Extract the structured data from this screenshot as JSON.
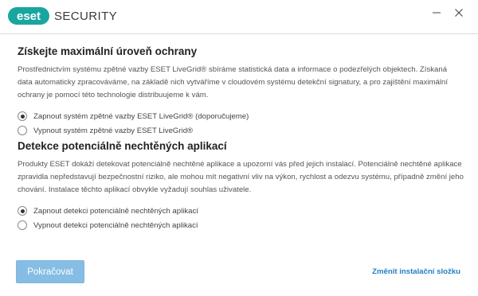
{
  "header": {
    "logo_text": "eset",
    "product_name": "SECURITY",
    "minimize_icon": "minimize-icon",
    "close_icon": "close-icon"
  },
  "livegrid": {
    "title": "Získejte maximální úroveň ochrany",
    "description": "Prostřednictvím systému zpětné vazby ESET LiveGrid® sbíráme statistická data a informace o podezřelých objektech. Získaná data automaticky zpracováváme, na základě nich vytváříme v cloudovém systému detekční signatury, a pro zajištění maximální ochrany je pomocí této technologie distribuujeme k vám.",
    "options": [
      {
        "label": "Zapnout systém zpětné vazby ESET LiveGrid® (doporučujeme)",
        "checked": true
      },
      {
        "label": "Vypnout systém zpětné vazby ESET LiveGrid®",
        "checked": false
      }
    ]
  },
  "pua": {
    "title": "Detekce potenciálně nechtěných aplikací",
    "description": "Produkty ESET dokáží detekovat potenciálně nechtěné aplikace a upozorní vás před jejich instalací. Potenciálně nechtěné aplikace zpravidla nepředstavují bezpečnostní riziko, ale mohou mít negativní vliv na výkon, rychlost a odezvu systému, případně změní jeho chování. Instalace těchto aplikací obvykle vyžadují souhlas uživatele.",
    "options": [
      {
        "label": "Zapnout detekci potenciálně nechtěných aplikací",
        "checked": true
      },
      {
        "label": "Vypnout detekci potenciálně nechtěných aplikací",
        "checked": false
      }
    ]
  },
  "footer": {
    "continue_label": "Pokračovat",
    "change_folder_label": "Změnit instalační složku"
  },
  "colors": {
    "brand_teal": "#1aa6a0",
    "button_bg": "#86bde5",
    "link": "#1f7fc4"
  }
}
